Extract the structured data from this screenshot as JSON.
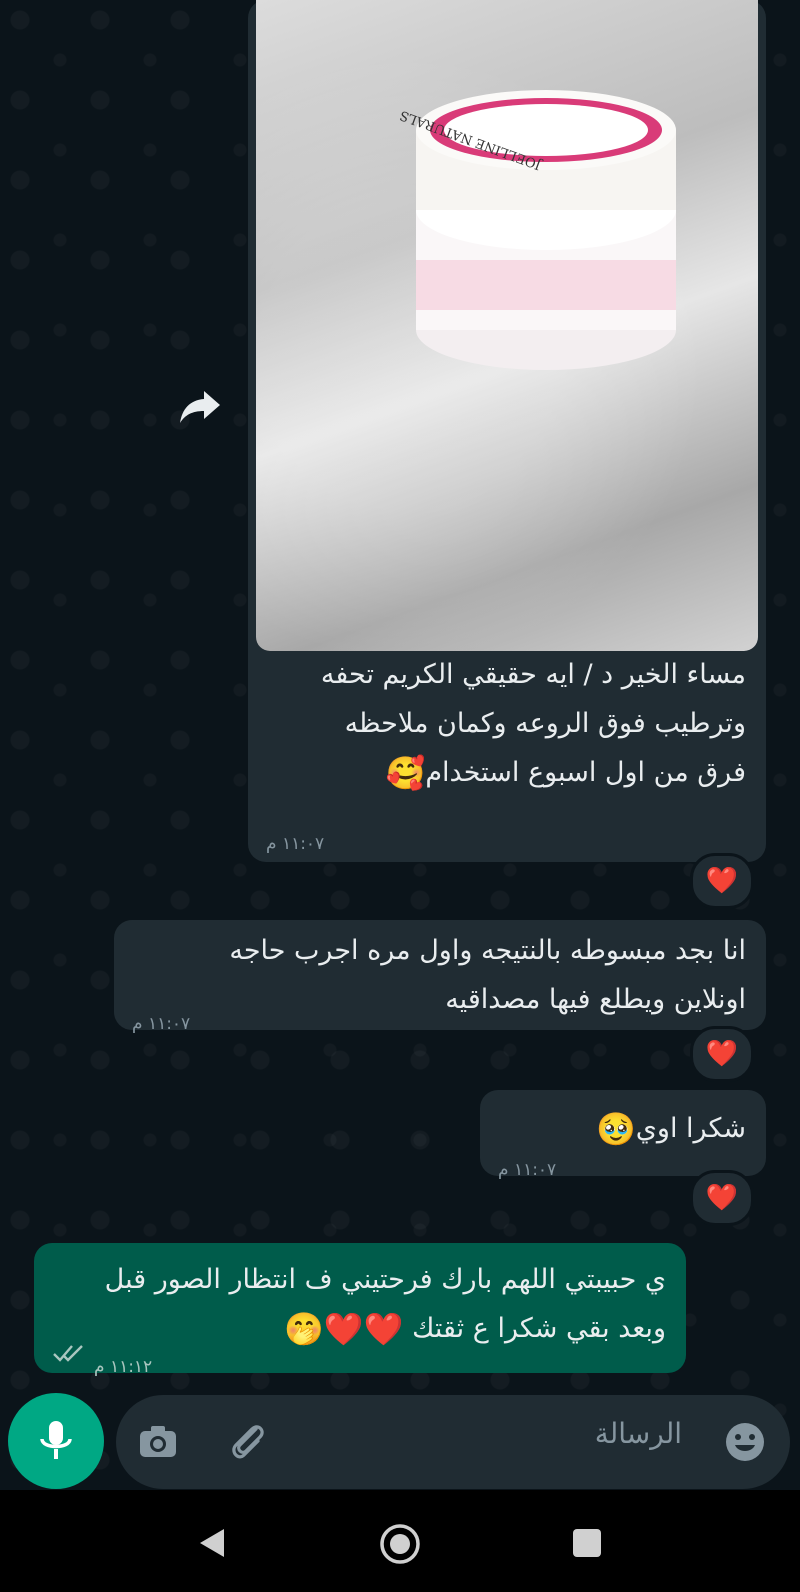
{
  "messages": [
    {
      "type": "incoming_image",
      "text_lines": [
        "مساء الخير د / ايه حقيقي الكريم تحفه",
        "وترطيب فوق الروعه وكمان ملاحظه",
        "فرق من اول اسبوع استخدام"
      ],
      "emoji": "🥰",
      "time": "١١:٠٧ م",
      "reaction": "❤️",
      "photo_label": "JOELLINE NATURALS"
    },
    {
      "type": "incoming_text",
      "text_lines": [
        "انا بجد مبسوطه بالنتيجه واول مره اجرب حاجه",
        "اونلاين ويطلع فيها مصداقيه"
      ],
      "time": "١١:٠٧ م",
      "reaction": "❤️"
    },
    {
      "type": "incoming_text",
      "text": "شكرا اوي",
      "emoji": "🥹",
      "time": "١١:٠٧ م",
      "reaction": "❤️"
    },
    {
      "type": "outgoing_text",
      "text_lines": [
        "ي حبيبتي اللهم بارك فرحتيني ف انتظار الصور قبل",
        "وبعد بقي شكرا ع ثقتك"
      ],
      "emoji": "❤️❤️🤭",
      "time": "١١:١٢ م",
      "status_icon": "double-check-icon"
    }
  ],
  "composer": {
    "placeholder": "الرسالة",
    "emoji_icon": "emoji-icon",
    "attach_icon": "paperclip-icon",
    "camera_icon": "camera-icon",
    "mic_icon": "mic-icon"
  },
  "colors": {
    "background": "#0b141a",
    "incoming_bubble": "#202c33",
    "outgoing_bubble": "#005c4b",
    "accent": "#00a884",
    "reaction_heart": "#e0283b"
  },
  "navbar": {
    "back_icon": "back-triangle-icon",
    "home_icon": "home-circle-icon",
    "recents_icon": "recents-square-icon"
  }
}
